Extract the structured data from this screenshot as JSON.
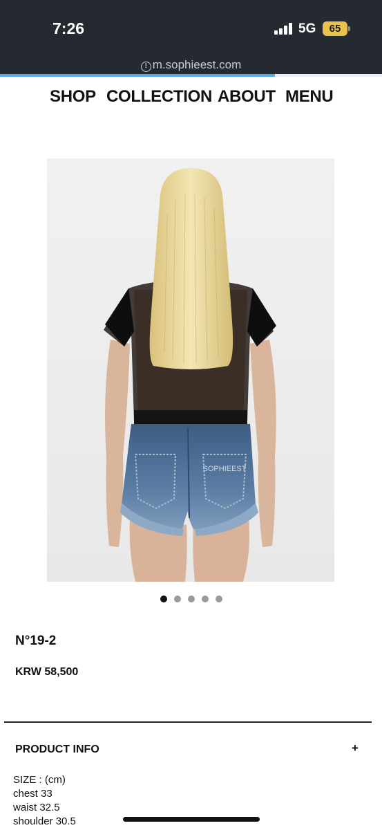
{
  "status": {
    "time": "7:26",
    "network": "5G",
    "battery": "65"
  },
  "browser": {
    "url": "m.sophieest.com",
    "url_icon": "info-icon",
    "load_progress": 0.72
  },
  "nav": {
    "items": [
      "SHOP",
      "COLLECTION",
      "ABOUT",
      "MENU"
    ]
  },
  "gallery": {
    "image_count": 5,
    "active_index": 0,
    "pocket_label": "SOPHIEEST"
  },
  "product": {
    "name": "N°19-2",
    "price": "KRW 58,500",
    "info_label": "PRODUCT INFO",
    "info_toggle": "+",
    "specs": [
      "SIZE : (cm)",
      "chest 33",
      "waist 32.5",
      "shoulder 30.5"
    ]
  },
  "colors": {
    "status_bg": "#252a31",
    "battery": "#e8c24a",
    "progress": "#5aa9e6"
  }
}
